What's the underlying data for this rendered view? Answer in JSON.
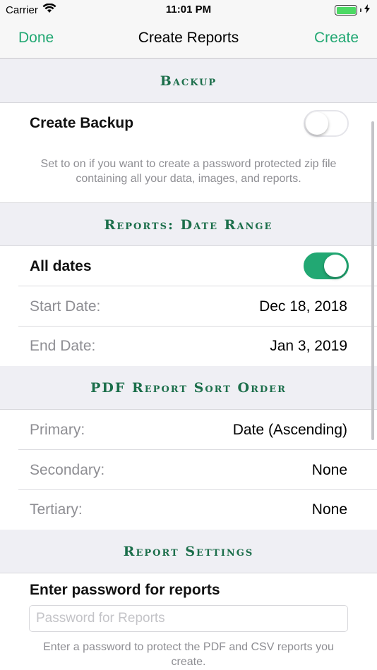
{
  "status_bar": {
    "carrier": "Carrier",
    "time": "11:01 PM",
    "battery_color": "#4cd964"
  },
  "nav": {
    "done_label": "Done",
    "title": "Create Reports",
    "create_label": "Create",
    "accent_color": "#22a873"
  },
  "backup": {
    "header": "Backup",
    "create_backup_label": "Create Backup",
    "create_backup_on": false,
    "footnote": "Set to on if you want to create a password protected zip file containing all your data, images, and reports."
  },
  "date_range": {
    "header": "Reports: Date Range",
    "all_dates_label": "All dates",
    "all_dates_on": true,
    "start_label": "Start Date:",
    "start_value": "Dec 18, 2018",
    "end_label": "End Date:",
    "end_value": "Jan 3, 2019"
  },
  "sort_order": {
    "header": "PDF Report Sort Order",
    "primary_label": "Primary:",
    "primary_value": "Date (Ascending)",
    "secondary_label": "Secondary:",
    "secondary_value": "None",
    "tertiary_label": "Tertiary:",
    "tertiary_value": "None"
  },
  "report_settings": {
    "header": "Report Settings",
    "password_label": "Enter password for reports",
    "password_placeholder": "Password for Reports",
    "password_value": "",
    "footnote": "Enter a password to protect the PDF and CSV reports you create."
  }
}
